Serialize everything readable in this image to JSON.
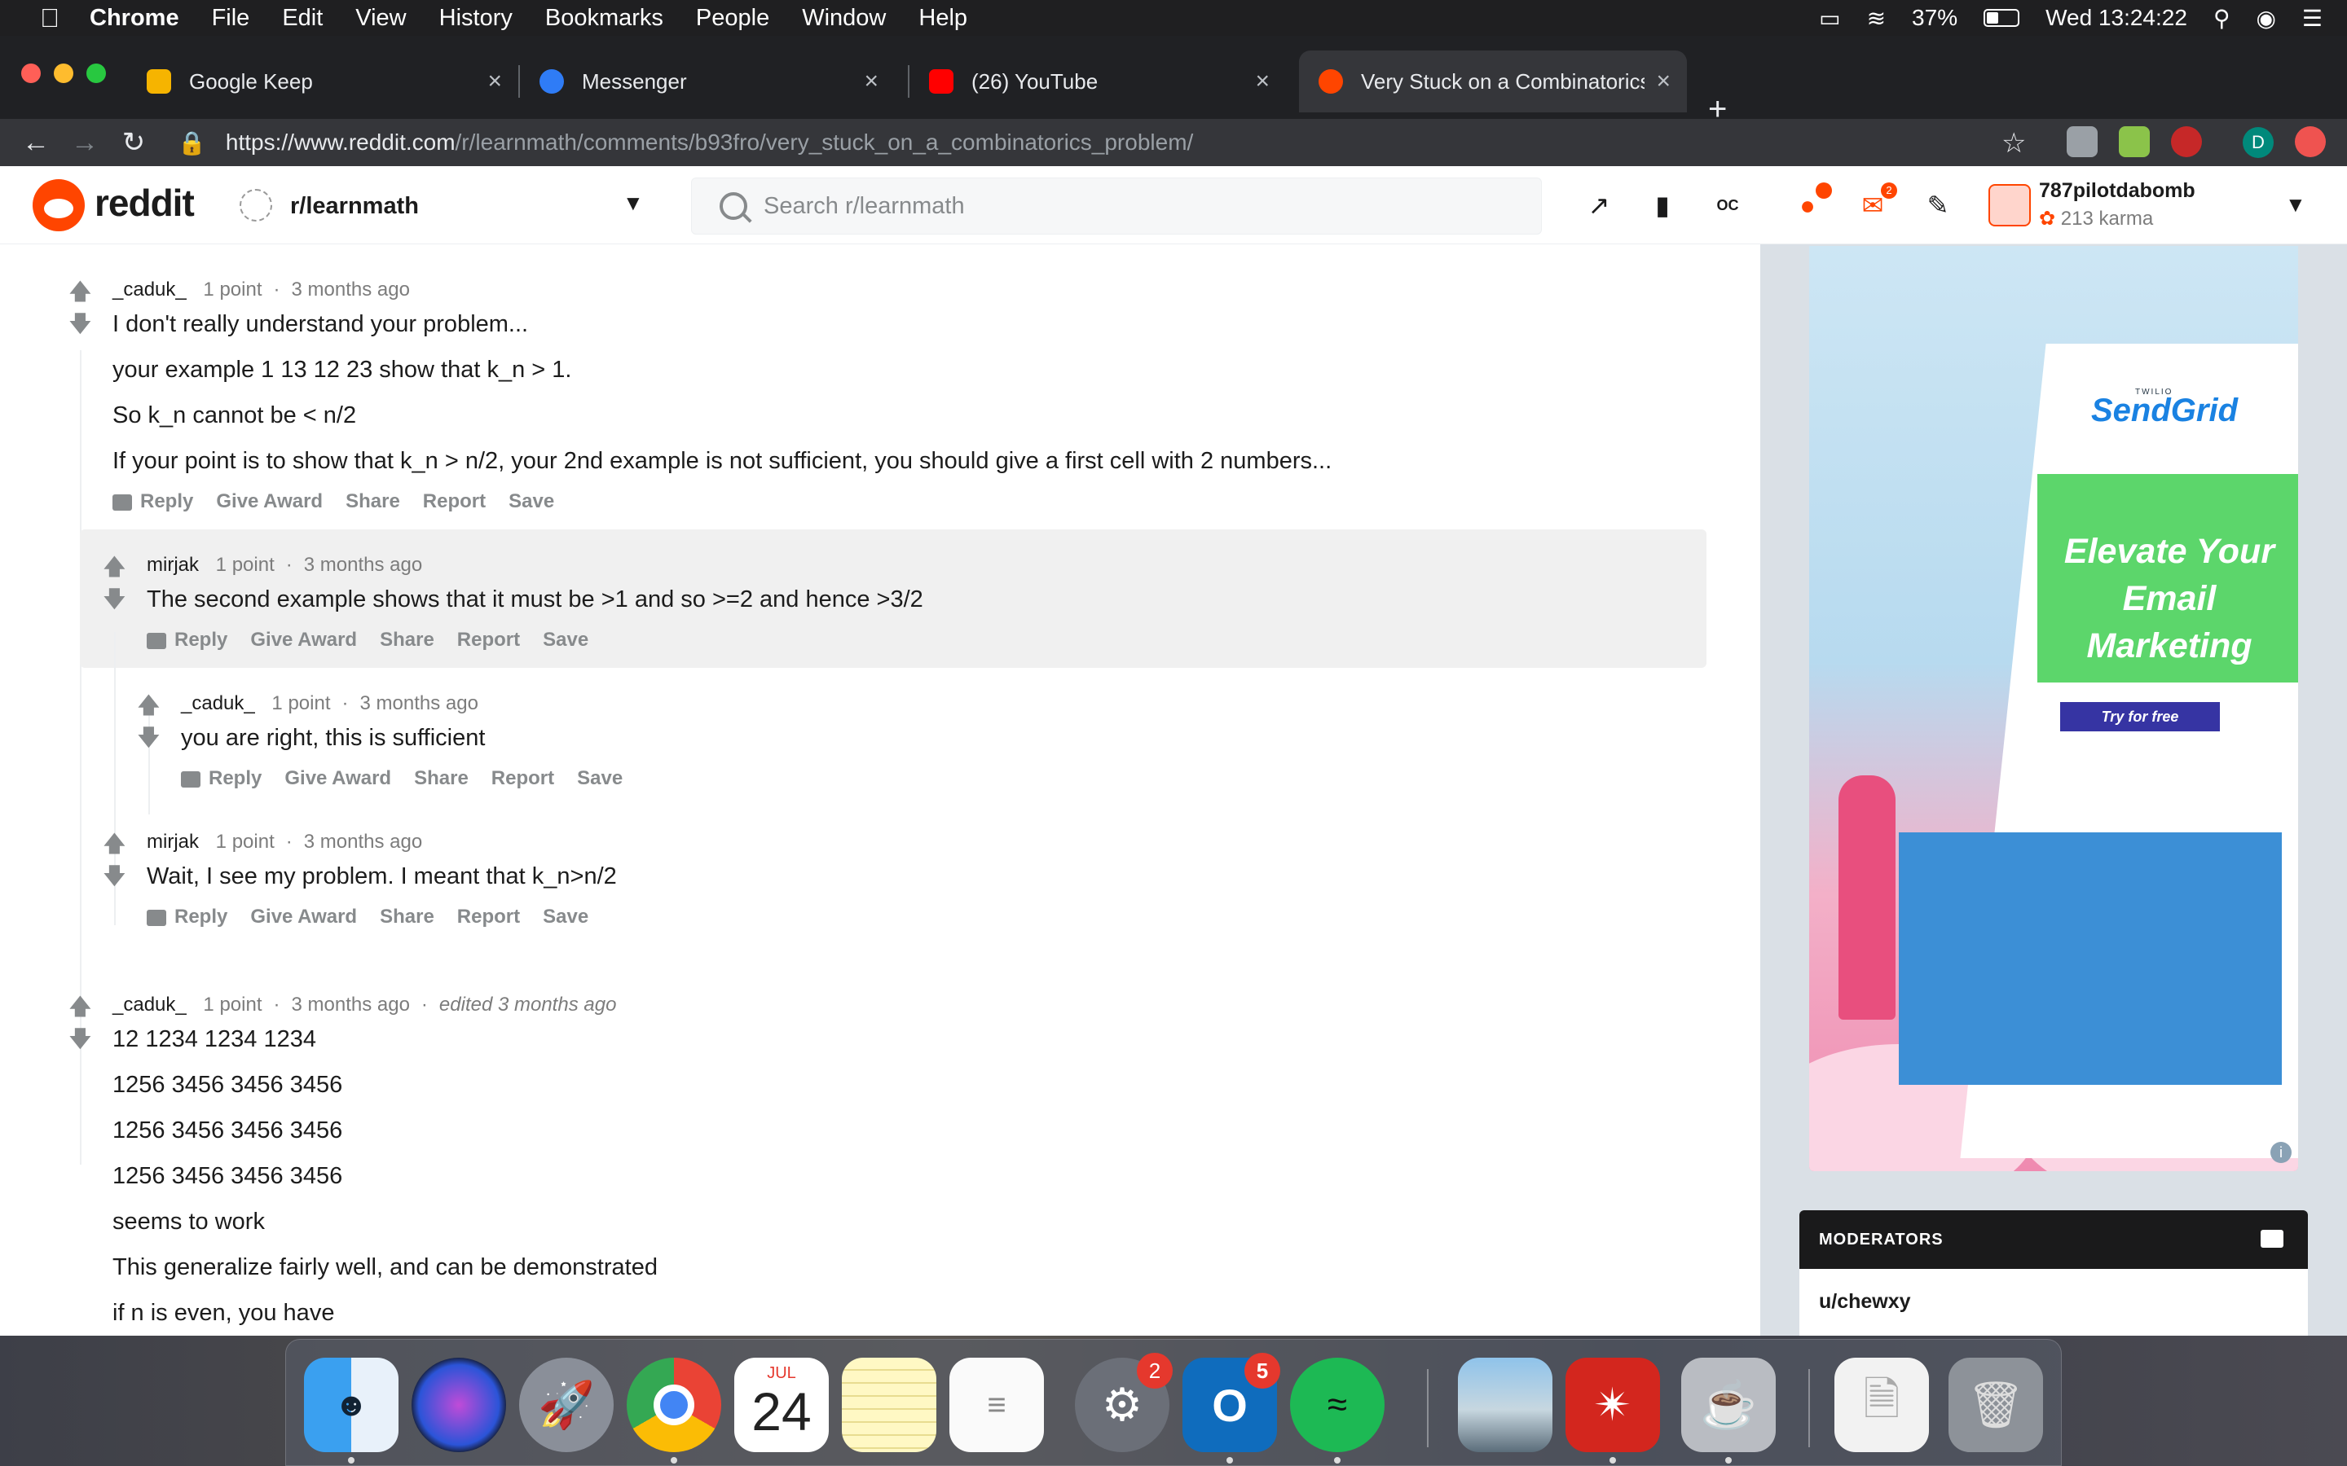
{
  "menubar": {
    "apple": "",
    "app": "Chrome",
    "items": [
      "File",
      "Edit",
      "View",
      "History",
      "Bookmarks",
      "People",
      "Window",
      "Help"
    ],
    "battery": "37%",
    "clock": "Wed 13:24:22"
  },
  "tabs": [
    {
      "title": "Google Keep",
      "close": "×",
      "fav_color": "#f6b400"
    },
    {
      "title": "Messenger",
      "close": "×",
      "fav_color": "#2f7cf6"
    },
    {
      "title": "(26) YouTube",
      "close": "×",
      "fav_color": "#ff0000"
    },
    {
      "title": "Very Stuck on a Combinatorics",
      "close": "×",
      "fav_color": "#ff4500"
    }
  ],
  "newtab": "+",
  "address": {
    "host": "https://www.reddit.com",
    "path": "/r/learnmath/comments/b93fro/very_stuck_on_a_combinatorics_problem/"
  },
  "reddit": {
    "wordmark": "reddit",
    "subreddit": "r/learnmath",
    "search_placeholder": "Search r/learnmath",
    "username": "787pilotdabomb",
    "karma": "213 karma",
    "mail_count": "2"
  },
  "comments": [
    {
      "author": "_caduk_",
      "points": "1 point",
      "time": "3 months ago",
      "lines": [
        "I don't really understand your problem...",
        "your example 1 13 12 23 show that k_n > 1.",
        "So k_n cannot be < n/2",
        "If your point is to show that k_n > n/2, your 2nd example is not sufficient, you should give a first cell with 2 numbers..."
      ]
    },
    {
      "author": "mirjak",
      "points": "1 point",
      "time": "3 months ago",
      "lines": [
        "The second example shows that it must be >1 and so >=2 and hence >3/2"
      ]
    },
    {
      "author": "_caduk_",
      "points": "1 point",
      "time": "3 months ago",
      "lines": [
        "you are right, this is sufficient"
      ]
    },
    {
      "author": "mirjak",
      "points": "1 point",
      "time": "3 months ago",
      "lines": [
        "Wait, I see my problem. I meant that k_n>n/2"
      ]
    },
    {
      "author": "_caduk_",
      "points": "1 point",
      "time": "3 months ago",
      "edited": "edited 3 months ago",
      "lines": [
        "12 1234 1234 1234",
        "1256 3456 3456 3456",
        "1256 3456 3456 3456",
        "1256 3456 3456 3456",
        "seems to work",
        "This generalize fairly well, and can be demonstrated",
        "if n is even, you have"
      ]
    }
  ],
  "actions": {
    "reply": "Reply",
    "award": "Give Award",
    "share": "Share",
    "report": "Report",
    "save": "Save"
  },
  "ad": {
    "brand_small": "TWILIO",
    "brand": "SendGrid",
    "headline": "Elevate Your Email Marketing",
    "cta": "Try for free",
    "info": "i"
  },
  "moderators": {
    "title": "MODERATORS",
    "first": "u/chewxy"
  },
  "dock": {
    "calendar_month": "JUL",
    "calendar_day": "24",
    "prefs_badge": "2",
    "outlook_badge": "5"
  }
}
